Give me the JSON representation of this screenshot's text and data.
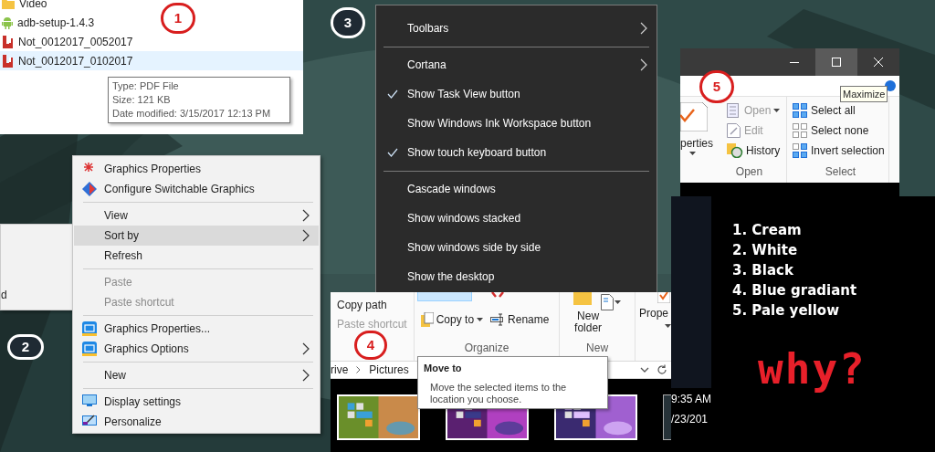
{
  "file_list": {
    "items": [
      {
        "name": "Video",
        "kind": "folder",
        "selected": false
      },
      {
        "name": "adb-setup-1.4.3",
        "kind": "app",
        "selected": false
      },
      {
        "name": "Not_0012017_0052017",
        "kind": "pdf",
        "selected": false
      },
      {
        "name": "Not_0012017_0102017",
        "kind": "pdf",
        "selected": true
      }
    ]
  },
  "file_tooltip": {
    "lines": [
      "Type: PDF File",
      "Size: 121 KB",
      "Date modified: 3/15/2017 12:13 PM"
    ]
  },
  "taskbar_menu": {
    "items": [
      {
        "kind": "item",
        "label": "Toolbars",
        "submenu": true,
        "checked": false
      },
      {
        "kind": "divider"
      },
      {
        "kind": "item",
        "label": "Cortana",
        "submenu": true,
        "checked": false
      },
      {
        "kind": "item",
        "label": "Show Task View button",
        "submenu": false,
        "checked": true
      },
      {
        "kind": "item",
        "label": "Show Windows Ink Workspace button",
        "submenu": false,
        "checked": false
      },
      {
        "kind": "item",
        "label": "Show touch keyboard button",
        "submenu": false,
        "checked": true
      },
      {
        "kind": "divider"
      },
      {
        "kind": "item",
        "label": "Cascade windows",
        "submenu": false,
        "checked": false
      },
      {
        "kind": "item",
        "label": "Show windows stacked",
        "submenu": false,
        "checked": false
      },
      {
        "kind": "item",
        "label": "Show windows side by side",
        "submenu": false,
        "checked": false
      },
      {
        "kind": "item",
        "label": "Show the desktop",
        "submenu": false,
        "checked": false
      }
    ]
  },
  "sort_submenu": {
    "text": "d"
  },
  "desktop_menu": {
    "items": [
      {
        "kind": "intel",
        "label": "Graphics Properties",
        "submenu": false,
        "selected": false,
        "disabled": false
      },
      {
        "kind": "switchable",
        "label": "Configure Switchable Graphics",
        "submenu": false,
        "selected": false,
        "disabled": false
      },
      {
        "kind": "divider"
      },
      {
        "kind": "plain",
        "label": "View",
        "submenu": true,
        "selected": false,
        "disabled": false
      },
      {
        "kind": "plain",
        "label": "Sort by",
        "submenu": true,
        "selected": true,
        "disabled": false
      },
      {
        "kind": "plain",
        "label": "Refresh",
        "submenu": false,
        "selected": false,
        "disabled": false
      },
      {
        "kind": "divider"
      },
      {
        "kind": "plain",
        "label": "Paste",
        "submenu": false,
        "selected": false,
        "disabled": true
      },
      {
        "kind": "plain",
        "label": "Paste shortcut",
        "submenu": false,
        "selected": false,
        "disabled": true
      },
      {
        "kind": "divider"
      },
      {
        "kind": "graphics",
        "label": "Graphics Properties...",
        "submenu": false,
        "selected": false,
        "disabled": false
      },
      {
        "kind": "graphics",
        "label": "Graphics Options",
        "submenu": true,
        "selected": false,
        "disabled": false
      },
      {
        "kind": "divider"
      },
      {
        "kind": "plain",
        "label": "New",
        "submenu": true,
        "selected": false,
        "disabled": false
      },
      {
        "kind": "divider"
      },
      {
        "kind": "display",
        "label": "Display settings",
        "submenu": false,
        "selected": false,
        "disabled": false
      },
      {
        "kind": "personalize",
        "label": "Personalize",
        "submenu": false,
        "selected": false,
        "disabled": false
      }
    ]
  },
  "explorer_ribbon": {
    "clipboard": [
      {
        "label": "Copy path",
        "disabled": false
      },
      {
        "label": "Paste shortcut",
        "disabled": true
      }
    ],
    "organize": {
      "label": "Organize",
      "buttons": [
        {
          "label": "Copy to",
          "kind": "copy",
          "dropdown": true
        },
        {
          "label": "Rename",
          "kind": "rename",
          "dropdown": false
        }
      ]
    },
    "new": {
      "label": "New",
      "button": "New folder"
    },
    "properties": "Prope"
  },
  "address_bar": {
    "segments": [
      "rive",
      "Pictures"
    ]
  },
  "move_tooltip": {
    "title": "Move to",
    "text": "Move the selected items to the location you choose."
  },
  "clock": {
    "time": "9:35 AM",
    "date": "/23/201"
  },
  "window": {
    "buttons": [
      {
        "kind": "minimize",
        "hovered": false
      },
      {
        "kind": "maximize",
        "hovered": true
      },
      {
        "kind": "close",
        "hovered": false
      }
    ],
    "tooltip": "Maximize",
    "properties": "perties",
    "open_group": {
      "label": "Open",
      "items": [
        {
          "label": "Open",
          "kind": "open",
          "dropdown": true,
          "disabled": true
        },
        {
          "label": "Edit",
          "kind": "edit",
          "dropdown": false,
          "disabled": true
        },
        {
          "label": "History",
          "kind": "history",
          "dropdown": false,
          "disabled": false
        }
      ]
    },
    "select_group": {
      "label": "Select",
      "items": [
        {
          "label": "Select all",
          "kind": "all"
        },
        {
          "label": "Select none",
          "kind": "none"
        },
        {
          "label": "Invert selection",
          "kind": "invert"
        }
      ]
    }
  },
  "note": {
    "lines": [
      "1. Cream",
      "2. White",
      "3. Black",
      "4. Blue gradiant",
      "5. Pale yellow"
    ],
    "exclamation": "why?"
  },
  "callouts": [
    {
      "label": "1"
    },
    {
      "label": "2"
    },
    {
      "label": "3"
    },
    {
      "label": "4"
    },
    {
      "label": "5"
    }
  ]
}
